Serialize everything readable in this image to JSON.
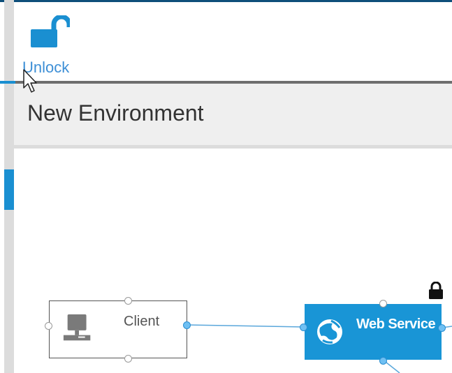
{
  "toolbar": {
    "unlock_label": "Unlock",
    "unlock_icon": "unlock-icon"
  },
  "environment": {
    "title": "New Environment"
  },
  "canvas": {
    "nodes": [
      {
        "id": "client",
        "label": "Client",
        "icon": "computer-icon",
        "selected": false
      },
      {
        "id": "web-service",
        "label": "Web Service",
        "icon": "globe-icon",
        "selected": true,
        "locked": true
      }
    ],
    "connections": [
      {
        "from": "client",
        "to": "web-service"
      }
    ]
  },
  "colors": {
    "accent": "#1a8fd1",
    "node_fill": "#1995d6",
    "link_text": "#3d8fd6",
    "header_bg": "#efefef",
    "rail": "#dcdcdc"
  }
}
